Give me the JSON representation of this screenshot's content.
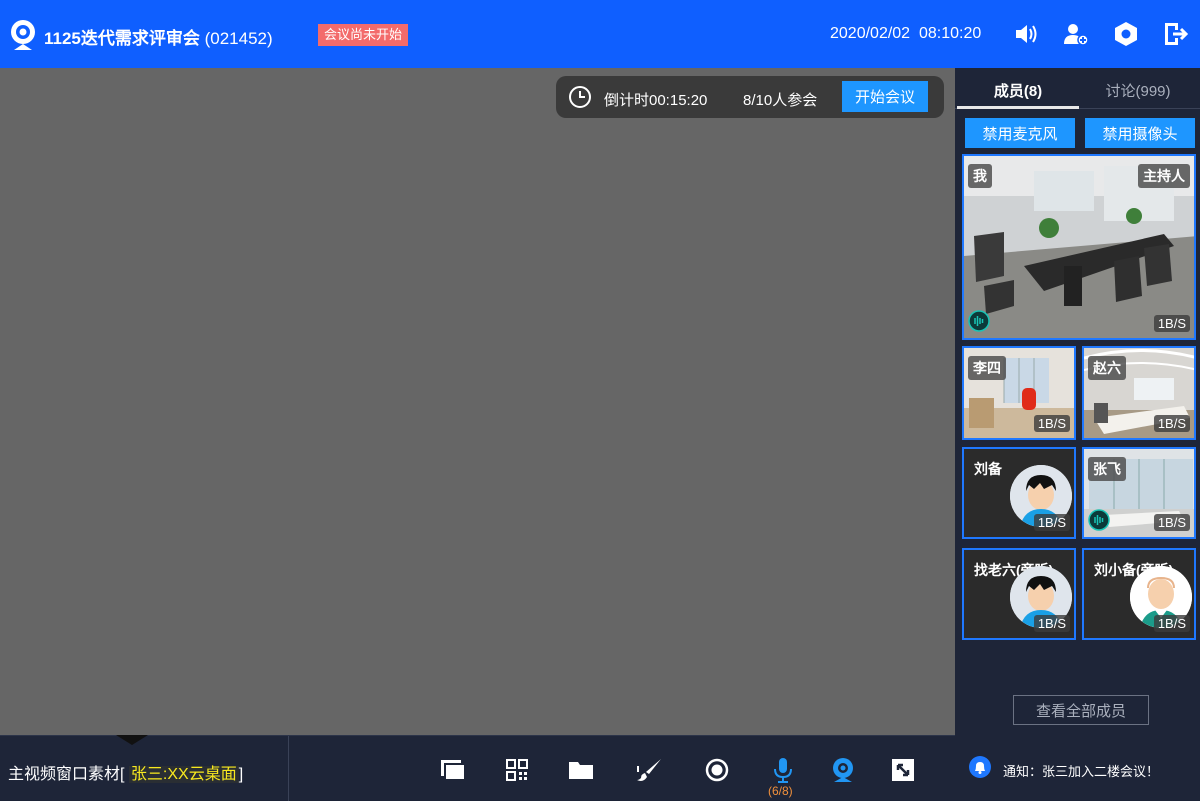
{
  "header": {
    "title_main": "1125迭代需求评审会",
    "title_code": " (021452)",
    "status_badge": "会议尚未开始",
    "date": "2020/02/02",
    "time": "08:10:20",
    "icons": [
      "volume-icon",
      "add-user-icon",
      "settings-icon",
      "exit-icon"
    ],
    "accent": "#0f5fff"
  },
  "main": {
    "countdown_label": "倒计时00:15:20",
    "attendance": "8/10人参会",
    "start_button": "开始会议",
    "source_prefix": "主视频窗口素材[ ",
    "source_name": "张三:XX云桌面",
    "source_suffix": "]",
    "toolbar": [
      "screen-share-icon",
      "qr-code-icon",
      "folder-icon",
      "whiteboard-icon",
      "record-icon",
      "microphone-icon",
      "camera-icon",
      "fullscreen-icon"
    ],
    "mic_count": "(6/8)"
  },
  "panel": {
    "tab_members": "成员(8)",
    "tab_discussion": "讨论(999)",
    "mute_mic": "禁用麦克风",
    "mute_camera": "禁用摄像头",
    "members": [
      {
        "name": "我",
        "role": "主持人",
        "rate": "1B/S"
      },
      {
        "name": "李四",
        "rate": "1B/S"
      },
      {
        "name": "赵六",
        "rate": "1B/S"
      },
      {
        "name": "刘备",
        "rate": "1B/S"
      },
      {
        "name": "张飞",
        "rate": "1B/S"
      },
      {
        "name": "找老六(旁听)",
        "rate": "1B/S"
      },
      {
        "name": "刘小备(旁听)",
        "rate": "1B/S"
      }
    ],
    "view_all": "查看全部成员",
    "notice": "通知：张三加入二楼会议！"
  }
}
